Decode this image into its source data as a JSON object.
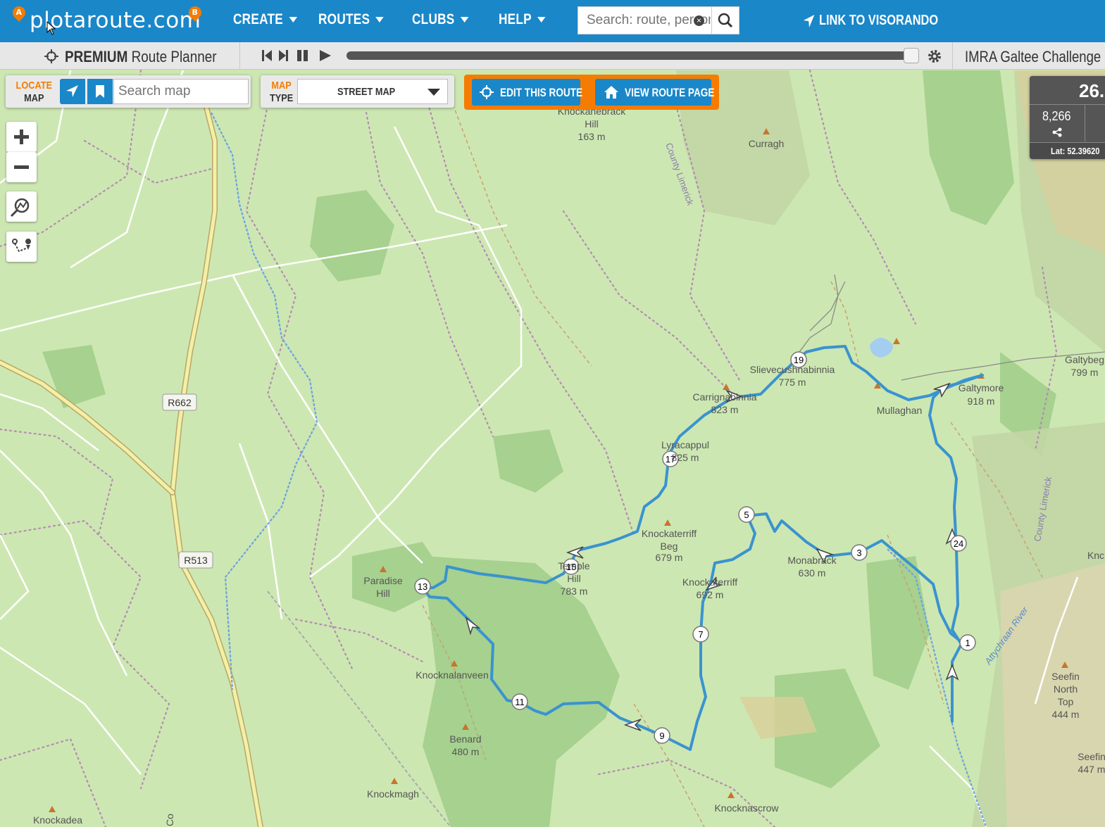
{
  "app": {
    "logo_text": "plotaroute.com",
    "logo_pin_a": "A",
    "logo_pin_b": "B"
  },
  "nav": {
    "items": [
      {
        "label": "CREATE"
      },
      {
        "label": "ROUTES"
      },
      {
        "label": "CLUBS"
      },
      {
        "label": "HELP"
      }
    ],
    "search_placeholder": "Search: route, person",
    "link_visorando": "LINK TO VISORANDO"
  },
  "subbar": {
    "premium": "PREMIUM",
    "planner": "Route Planner",
    "route_title": "IMRA Galtee Challenge Du"
  },
  "locate_panel": {
    "label_top": "LOCATE",
    "label_bottom": "MAP",
    "search_placeholder": "Search map"
  },
  "map_type_panel": {
    "label_top": "MAP",
    "label_bottom": "TYPE",
    "selected": "STREET MAP"
  },
  "route_actions": {
    "edit": "EDIT THIS ROUTE",
    "view": "VIEW ROUTE PAGE"
  },
  "stats": {
    "distance": "26.",
    "elevation": "8,266",
    "lat": "Lat: 52.39620"
  },
  "colors": {
    "brand_blue": "#1a87c9",
    "accent_orange": "#f57c00",
    "route_line": "#3a93cf"
  },
  "map_labels": {
    "knockanebrack": [
      "Knockanebrack",
      "Hill",
      "163 m"
    ],
    "curragh": "Curragh",
    "county_limerick_1": "County Limerick",
    "county_limerick_2": "County Limerick",
    "slievecushnabinnia": [
      "Slievecushnabinnia",
      "775 m"
    ],
    "carrignabinnia": [
      "Carrignabinnia",
      "823 m"
    ],
    "mullaghanattin": "Mullaghan",
    "galtymore": [
      "Galtymore",
      "918 m"
    ],
    "galtybeg": [
      "Galtybeg",
      "799 m"
    ],
    "lyracappul": [
      "Lyracappul",
      "825 m"
    ],
    "knockaterriff_beg": [
      "Knockaterriff",
      "Beg",
      "679 m"
    ],
    "monabrack": [
      "Monabrack",
      "630 m"
    ],
    "knockaterriff": [
      "Knockaterriff",
      "692 m"
    ],
    "temple_hill": [
      "Temple",
      "Hill",
      "783 m"
    ],
    "paradise_hill": [
      "Paradise",
      "Hill"
    ],
    "knocknalanveen": "Knocknalanveen",
    "benard": [
      "Benard",
      "480 m"
    ],
    "knockmagh": "Knockmagh",
    "knockadea": "Knockadea",
    "knocknascrow": "Knocknascrow",
    "seefin_north": [
      "Seefin",
      "North",
      "Top",
      "444 m"
    ],
    "seefin": [
      "Seefin",
      "447 m"
    ],
    "knc": "Knc",
    "aherlow_river": "Attychraan River",
    "r662": "R662",
    "r513": "R513",
    "co": "Co"
  },
  "waypoints": [
    "1",
    "3",
    "5",
    "7",
    "9",
    "11",
    "13",
    "15",
    "17",
    "19",
    "24"
  ]
}
